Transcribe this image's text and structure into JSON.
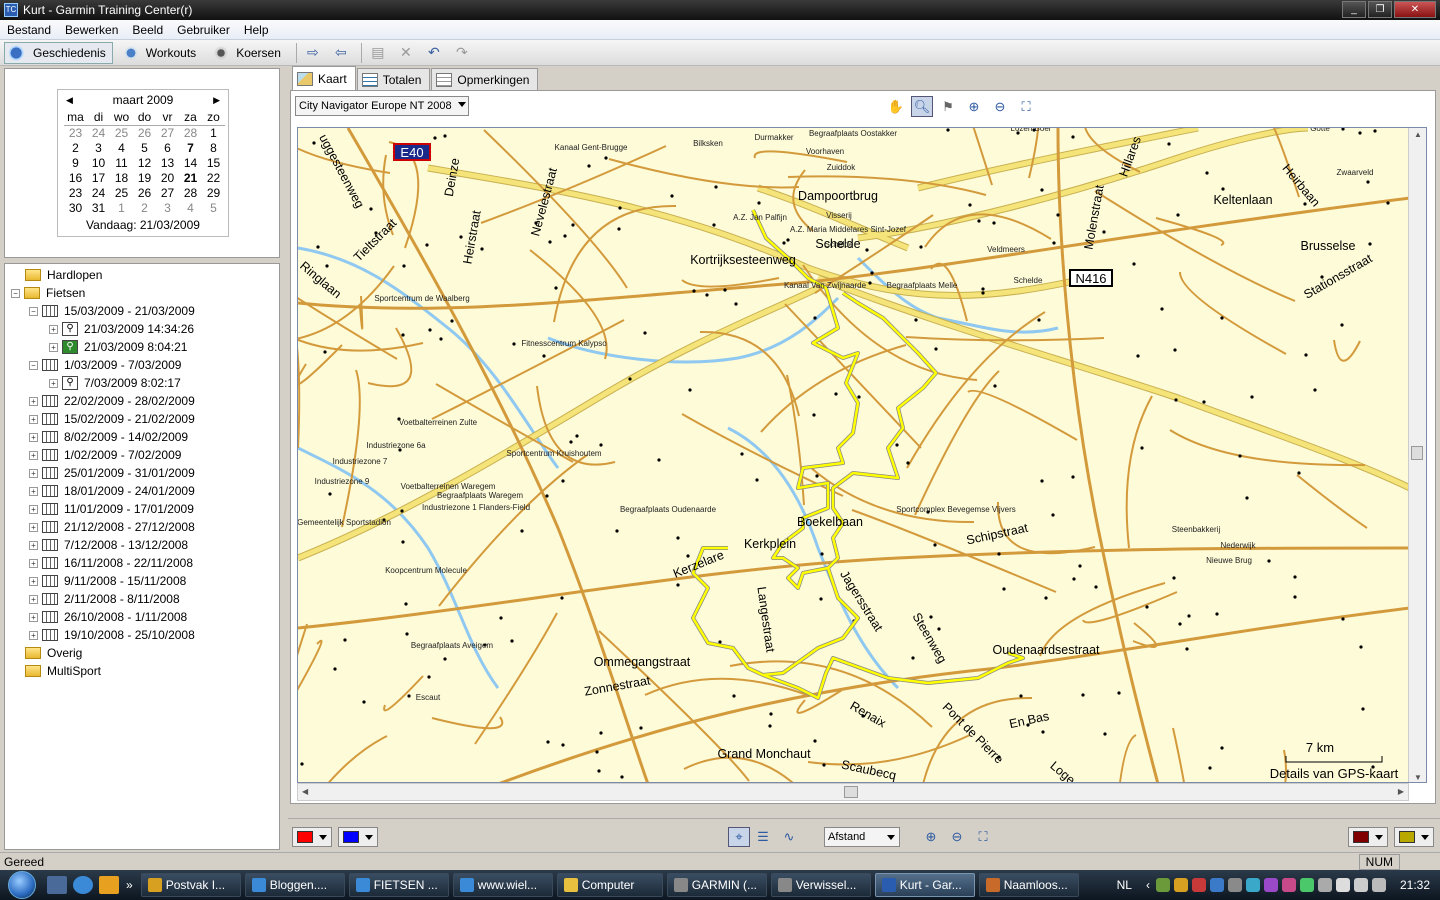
{
  "window": {
    "title": "Kurt - Garmin Training Center(r)",
    "app_icon": "TC"
  },
  "menu": [
    "Bestand",
    "Bewerken",
    "Beeld",
    "Gebruiker",
    "Help"
  ],
  "toolbar": {
    "history_label": "Geschiedenis",
    "workouts_label": "Workouts",
    "courses_label": "Koersen"
  },
  "calendar": {
    "month": "maart 2009",
    "weekdays": [
      "ma",
      "di",
      "wo",
      "do",
      "vr",
      "za",
      "zo"
    ],
    "rows": [
      [
        "23",
        "24",
        "25",
        "26",
        "27",
        "28",
        "1"
      ],
      [
        "2",
        "3",
        "4",
        "5",
        "6",
        "7",
        "8"
      ],
      [
        "9",
        "10",
        "11",
        "12",
        "13",
        "14",
        "15"
      ],
      [
        "16",
        "17",
        "18",
        "19",
        "20",
        "21",
        "22"
      ],
      [
        "23",
        "24",
        "25",
        "26",
        "27",
        "28",
        "29"
      ],
      [
        "30",
        "31",
        "1",
        "2",
        "3",
        "4",
        "5"
      ]
    ],
    "today": "Vandaag: 21/03/2009"
  },
  "tree": {
    "hardlopen": "Hardlopen",
    "fietsen": "Fietsen",
    "week1": "15/03/2009 - 21/03/2009",
    "act1": "21/03/2009 14:34:26",
    "act2": "21/03/2009 8:04:21",
    "week2": "1/03/2009 - 7/03/2009",
    "act3": "7/03/2009 8:02:17",
    "weeks": [
      "22/02/2009 - 28/02/2009",
      "15/02/2009 - 21/02/2009",
      "8/02/2009 - 14/02/2009",
      "1/02/2009 - 7/02/2009",
      "25/01/2009 - 31/01/2009",
      "18/01/2009 - 24/01/2009",
      "11/01/2009 - 17/01/2009",
      "21/12/2008 - 27/12/2008",
      "7/12/2008 - 13/12/2008",
      "16/11/2008 - 22/11/2008",
      "9/11/2008 - 15/11/2008",
      "2/11/2008 - 8/11/2008",
      "26/10/2008 - 1/11/2008",
      "19/10/2008 - 25/10/2008"
    ],
    "overig": "Overig",
    "multisport": "MultiSport"
  },
  "tabs": {
    "map": "Kaart",
    "totals": "Totalen",
    "notes": "Opmerkingen"
  },
  "map": {
    "map_product": "City Navigator Europe NT 2008",
    "scale_label": "7 km",
    "details_label": "Details van GPS-kaart",
    "shield_e40": "E40",
    "shield_n416": "N416",
    "labels_major": [
      "Dampoortbrug",
      "Kortrijksesteenweg",
      "Keltenlaan",
      "Brusselse",
      "Stationsstraat",
      "Boekelbaan",
      "Kerkplein",
      "Kerzelare",
      "Langestraat",
      "Jagersstraat",
      "Steenweg",
      "Oudenaardsestraat",
      "Ommegangstraat",
      "Zonnestraat",
      "Renaix",
      "Pont de Pierre",
      "En Bas",
      "Loge",
      "Grand Monchaut",
      "Scaubecq",
      "Schipstraat",
      "Molenstraat",
      "Hillares",
      "Heirbaan",
      "Heirstraat",
      "Nevelestraat",
      "Deinze",
      "Tieltstraat",
      "Ringlaan",
      "uggesteenweg",
      "Scheldе"
    ],
    "labels_minor": [
      "Kanaal Gent-Brugge",
      "Bilksken",
      "Durmakker",
      "Begraafplaats Oostakker",
      "Voorhaven",
      "Zuiddok",
      "Visserij",
      "A.Z. Jan Palfijn",
      "A.Z. Maria Middelares Sint-Jozef",
      "Scheldе",
      "Kanaal Van Zwijnaarde",
      "Begraafplaats Melle",
      "Veldmeers",
      "Scheldе",
      "Sportcentrum de Waalberg",
      "Fitnesscentrum Kalypso",
      "Voetbalterreinen Zulte",
      "Industriezone 6a",
      "Industriezone 7",
      "Sportcentrum Kruishoutem",
      "Industriezone 9",
      "Voetbalterreinen Waregem",
      "Begraafplaats Waregem",
      "Industriezone 1 Flanders-Field",
      "Begraafplaats Oudenaarde",
      "Sportcomplex Bevegemse Vijvers",
      "Gemeentelijk Sportstadion",
      "Koopcentrum Molecule",
      "Steenbakkerij",
      "Nederwijk",
      "Nieuwe Brug",
      "Begraafplaats Aveigem",
      "Escaut",
      "Zwaarveld",
      "Lozen Boer",
      "Gotte"
    ]
  },
  "bottom": {
    "metric": "Afstand",
    "color1": "#ff0000",
    "color2": "#0000ff",
    "color3": "#800000",
    "color4": "#b8a800"
  },
  "status": {
    "text": "Gereed",
    "num": "NUM"
  },
  "taskbar": {
    "tasks": [
      "Postvak I...",
      "Bloggen....",
      "FIETSEN ...",
      "www.wiel...",
      "Computer",
      "GARMIN (...",
      "Verwissel...",
      "Kurt - Gar...",
      "Naamloos..."
    ],
    "lang": "NL",
    "clock": "21:32"
  },
  "colors": {
    "map_bg": "#fefbd8",
    "road": "#d39a3c",
    "highway": "#f5e47a",
    "track": "#ffff00",
    "water": "#8fc8f0"
  }
}
